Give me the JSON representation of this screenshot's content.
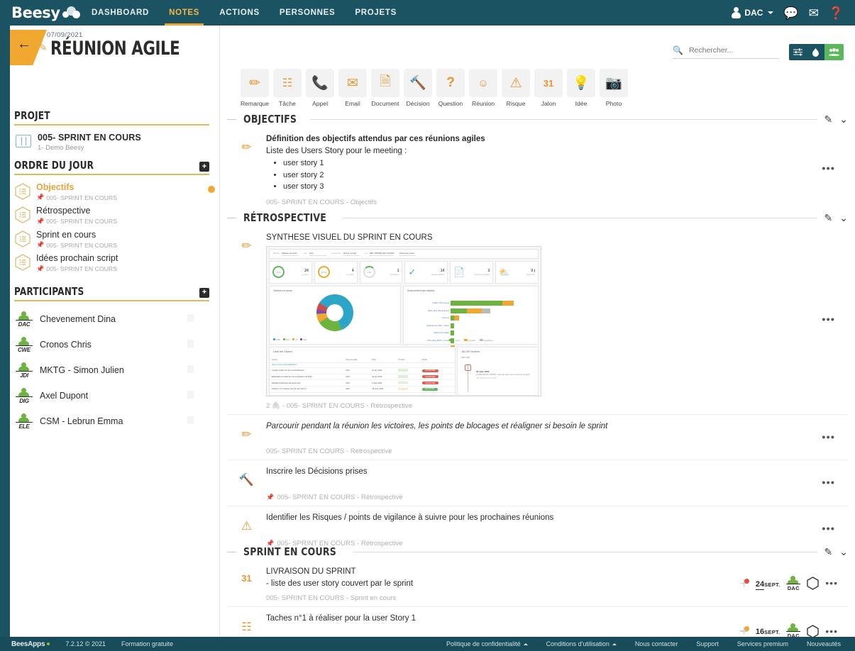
{
  "topnav": {
    "brand": "Beesy",
    "items": [
      {
        "label": "DASHBOARD",
        "active": false
      },
      {
        "label": "NOTES",
        "active": true
      },
      {
        "label": "ACTIONS",
        "active": false
      },
      {
        "label": "PERSONNES",
        "active": false
      },
      {
        "label": "PROJETS",
        "active": false
      }
    ],
    "user": "DAC",
    "icons": [
      "chat-icon",
      "mail-icon",
      "help-icon"
    ]
  },
  "header": {
    "date": "07/09/2021",
    "title": "RÉUNION AGILE",
    "back_label": "←"
  },
  "search": {
    "placeholder": "Rechercher...",
    "value": ""
  },
  "toolbar": {
    "filter_label": "⚌",
    "download_label": "⬤",
    "people_label": "👥"
  },
  "iconstrip": [
    {
      "label": "Remarque",
      "icon": "pencil-icon"
    },
    {
      "label": "Tâche",
      "icon": "checklist-icon"
    },
    {
      "label": "Appel",
      "icon": "phone-icon"
    },
    {
      "label": "Email",
      "icon": "envelope-icon"
    },
    {
      "label": "Document",
      "icon": "document-icon"
    },
    {
      "label": "Décision",
      "icon": "gavel-icon"
    },
    {
      "label": "Question",
      "icon": "question-icon"
    },
    {
      "label": "Réunion",
      "icon": "meeting-icon"
    },
    {
      "label": "Risque",
      "icon": "warning-icon"
    },
    {
      "label": "Jalon",
      "icon": "calendar-icon"
    },
    {
      "label": "Idée",
      "icon": "bulb-icon"
    },
    {
      "label": "Photo",
      "icon": "camera-icon"
    }
  ],
  "sidebar": {
    "project_heading": "PROJET",
    "project": {
      "name": "005- SPRINT EN COURS",
      "sub": "1- Demo Beesy"
    },
    "agenda_heading": "ORDRE DU JOUR",
    "agenda_add": "+",
    "agenda": [
      {
        "name": "Objectifs",
        "sub": "005- SPRINT EN COURS",
        "active": true
      },
      {
        "name": "Rétrospective",
        "sub": "005- SPRINT EN COURS",
        "active": false
      },
      {
        "name": "Sprint en cours",
        "sub": "005- SPRINT EN COURS",
        "active": false
      },
      {
        "name": "Idées prochain script",
        "sub": "005- SPRINT EN COURS",
        "active": false
      }
    ],
    "participants_heading": "PARTICIPANTS",
    "participants_add": "+",
    "participants": [
      {
        "initials": "DAC",
        "name": "Chevenement Dina"
      },
      {
        "initials": "CWE",
        "name": "Cronos Chris"
      },
      {
        "initials": "JDI",
        "name": "MKTG - Simon Julien"
      },
      {
        "initials": "DIG",
        "name": "Axel Dupont"
      },
      {
        "initials": "ELE",
        "name": "CSM - Lebrun Emma"
      }
    ]
  },
  "sections": [
    {
      "title": "OBJECTIFS",
      "rows": [
        {
          "icon": "pencil-icon",
          "title": "Définition des objectifs attendus par ces réunions agiles",
          "subtitle": "Liste des Users Story pour le meeting :",
          "bullets": [
            "user story 1",
            "user story 2",
            "user story 3"
          ],
          "footer": "005- SPRINT EN COURS - Objectifs",
          "footer_pin": false,
          "menu": "•••"
        }
      ]
    },
    {
      "title": "RÉTROSPECTIVE",
      "rows": [
        {
          "icon": "pencil-icon",
          "title": "SYNTHESE VISUEL DU SPRINT EN COURS",
          "has_image": true,
          "footer": "2 🖇 - 005- SPRINT EN COURS - Rétrospective",
          "attachments": "2",
          "footer_pin": false,
          "menu": "•••"
        },
        {
          "icon": "pencil-icon",
          "title": "Parcourir pendant la réunion les victoires, les points de blocages et réaligner si besoin le sprint",
          "italic": true,
          "footer": "005- SPRINT EN COURS - Rétrospective",
          "footer_pin": false,
          "menu": "•••"
        },
        {
          "icon": "gavel-icon",
          "title": "Inscrire les Décisions prises",
          "footer": "005- SPRINT EN COURS - Rétrospective",
          "footer_pin": true,
          "menu": "•••"
        },
        {
          "icon": "warning-icon",
          "title": "Identifier les Risques / points de vigilance à suivre pour les prochaines réunions",
          "footer": "005- SPRINT EN COURS - Rétrospective",
          "footer_pin": true,
          "menu": "•••"
        }
      ]
    },
    {
      "title": "SPRINT EN COURS",
      "rows": [
        {
          "icon": "calendar-icon",
          "title": "LIVRAISON DU SPRINT",
          "subtitle": " - liste des user story couvert par le sprint",
          "footer": "005- SPRINT EN COURS - Sprint en cours",
          "footer_pin": false,
          "menu": "•••",
          "meta": {
            "day": "24",
            "month": "SEPT.",
            "owner": "DAC",
            "bead_color": "#e74c3c"
          }
        },
        {
          "icon": "checklist-icon",
          "title": "Taches n°1 à réaliser pour la user Story 1",
          "footer": "",
          "footer_pin": false,
          "menu": "•••",
          "meta": {
            "day": "16",
            "month": "SEPT.",
            "owner": "DAC",
            "bead_color": "#f0a830"
          }
        }
      ]
    }
  ],
  "section_actions": {
    "edit": "✎",
    "collapse": "⌄"
  },
  "footer": {
    "brand": "BeesApps",
    "version": "7.2.12 © 2021",
    "plan": "Formation gratuite",
    "links": [
      {
        "label": "Politique de confidentialité",
        "caret": true
      },
      {
        "label": "Conditions d'utilisation",
        "caret": true
      },
      {
        "label": "Nous contacter",
        "caret": false
      },
      {
        "label": "Support",
        "caret": false
      },
      {
        "label": "Services premium",
        "caret": false
      },
      {
        "label": "Nouveautés",
        "caret": false
      }
    ]
  },
  "embedded_dashboard": {
    "filters": [
      {
        "label": "Afficher",
        "value": "Tableau de bord"
      },
      {
        "label": "pour",
        "value": "Tout"
      },
      {
        "label": "Concernant",
        "value": "Tout le monde"
      },
      {
        "label": "sur",
        "value": "005- SPRINT EN COURS"
      },
      {
        "label": "",
        "value": "Toutes les notes"
      }
    ],
    "kpis": [
      {
        "value": "24",
        "label": "en cours",
        "ring": "73 %"
      },
      {
        "value": "4",
        "label": "en retard",
        "ring": "16 %"
      },
      {
        "value": "1",
        "label": "complétées",
        "ring": "4 %"
      },
      {
        "value": "14",
        "label": "actions validées",
        "ring": ""
      },
      {
        "value": "3",
        "label": "documents publiés",
        "ring": ""
      },
      {
        "value": "0 j",
        "label": "projet à fin",
        "ring": ""
      }
    ],
    "donut_title": "Tâches en cours",
    "bars_title": "Avancement des tâches",
    "bar_rows": [
      {
        "label": "(CWE) Chris Cronos",
        "en_cours": 62,
        "en_retard": 14,
        "completees": 0
      },
      {
        "label": "(DAC) Dina Chevenement",
        "en_cours": 20,
        "en_retard": 18,
        "completees": 10
      },
      {
        "label": "(AX) A X",
        "en_cours": 4,
        "en_retard": 6,
        "completees": 0
      },
      {
        "label": "(ELE) Emma CSM - Lebrun",
        "en_cours": 4,
        "en_retard": 0,
        "completees": 0
      },
      {
        "label": "(SIM) Simon Julien",
        "en_cours": 4,
        "en_retard": 0,
        "completees": 0
      },
      {
        "label": "(JPJ) Julien MKTG - Simon",
        "en_cours": 4,
        "en_retard": 0,
        "completees": 0
      },
      {
        "label": "(DIG) Axel Dupont",
        "en_cours": 0,
        "en_retard": 5,
        "completees": 0
      }
    ],
    "bar_legend": [
      "en cours",
      "en retard",
      "complétées"
    ],
    "table_title": "Liste des Tâches",
    "table_headers": [
      "Action",
      "Responsable",
      "Date",
      "Priorité",
      "Statut"
    ],
    "table_group": "(DAC) DINA CHEVENEMENT",
    "table_rows": [
      {
        "action": "Create a video for the new Dashboard",
        "resp": "DAC",
        "date": "21 juil. 2021",
        "prio": "low",
        "statut": "EN RETARD"
      },
      {
        "action": "Elaboration du plan de communication Q4 2021",
        "resp": "DAC",
        "date": "29 juil. 2021",
        "prio": "low",
        "statut": "EN RETARD"
      },
      {
        "action": "Planifier la Réunion de lancement",
        "resp": "DAC",
        "date": "9 août 2021",
        "prio": "low",
        "statut": "EN RETARD"
      },
      {
        "action": "Taches n°1 à réaliser pour la user Story 1",
        "resp": "DAC",
        "date": "16 sept. 2021",
        "prio": "urgent",
        "statut": "EN COURS"
      }
    ],
    "timeline_title": "JALON Timeline",
    "timeline_period": "SEP 2021",
    "timeline_item": {
      "date": "24 sept. 2021",
      "text": "LIVRAISON DU SPRINT - liste des user story couvert par le sprint",
      "sub": "005- SPRINT EN COURS"
    }
  }
}
